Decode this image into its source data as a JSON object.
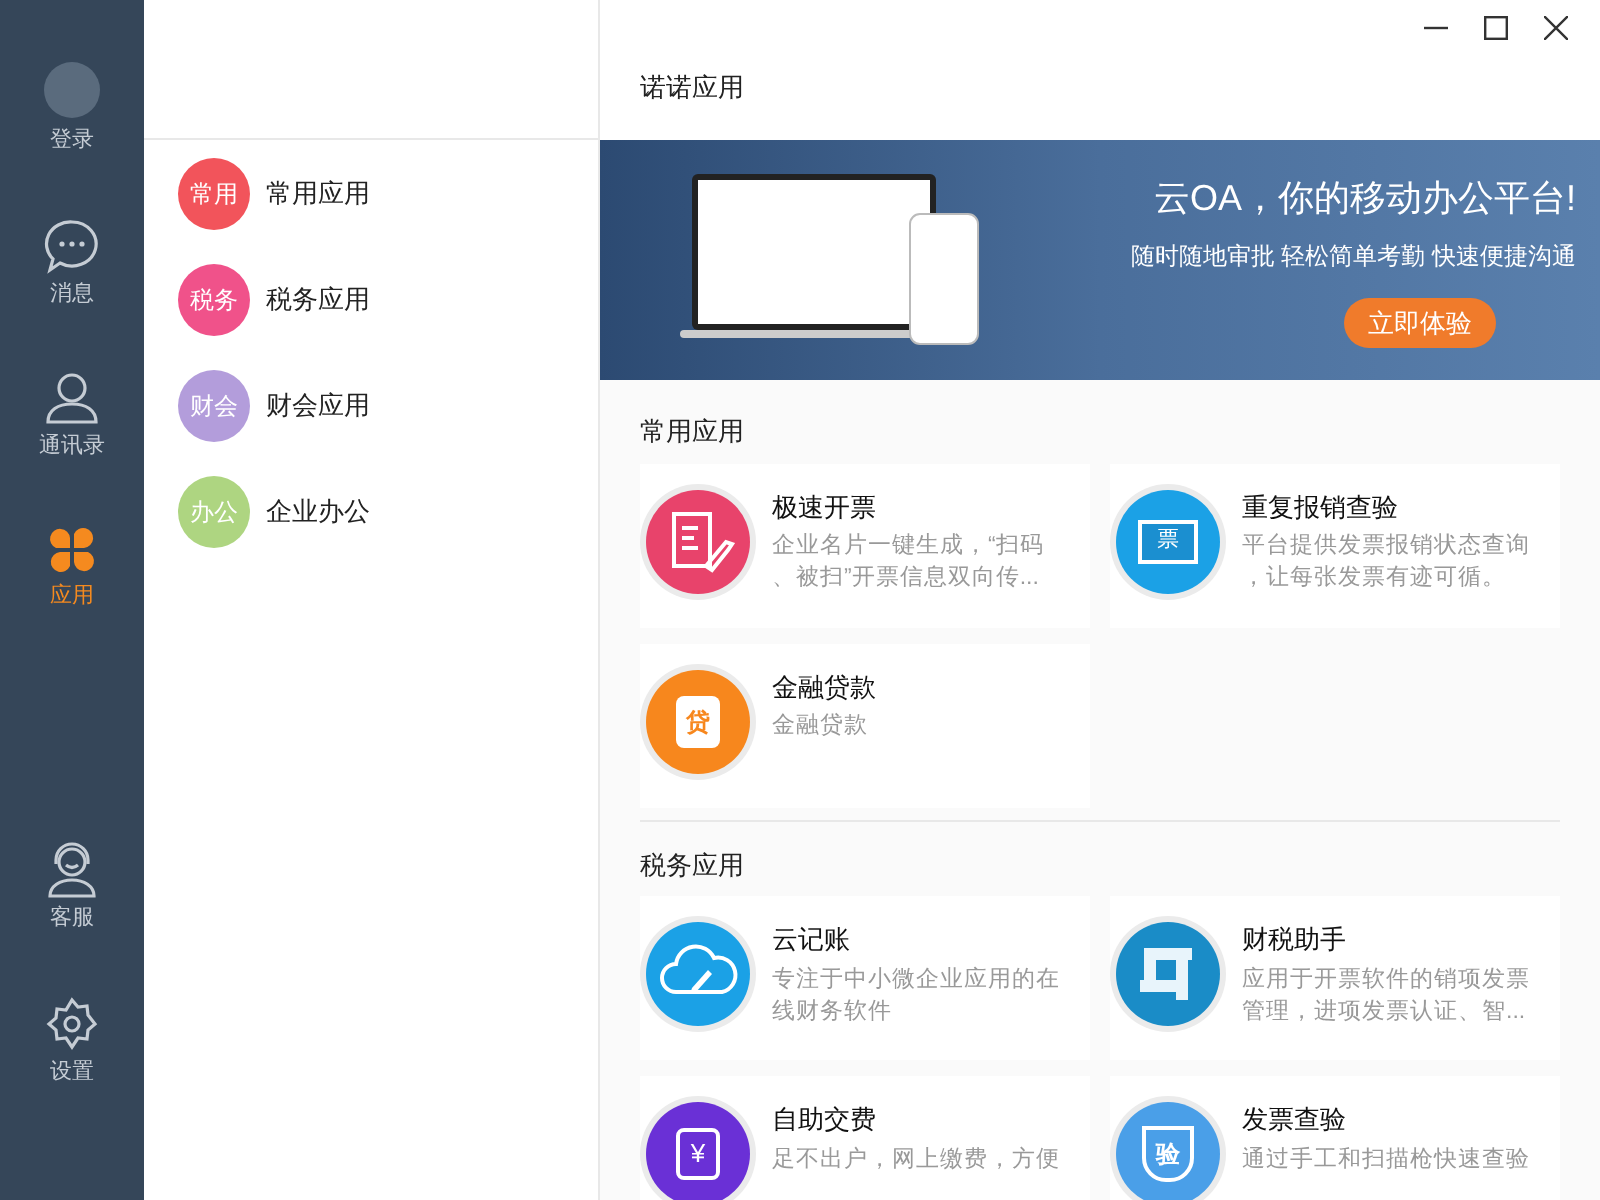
{
  "sidebar": {
    "items": [
      {
        "kind": "login",
        "label": "登录",
        "selected": false
      },
      {
        "kind": "messages",
        "label": "消息",
        "selected": false
      },
      {
        "kind": "contacts",
        "label": "通讯录",
        "selected": false
      },
      {
        "kind": "apps",
        "label": "应用",
        "selected": true
      },
      {
        "kind": "support",
        "label": "客服",
        "selected": false
      },
      {
        "kind": "settings",
        "label": "设置",
        "selected": false
      }
    ]
  },
  "categories": [
    {
      "badge": "常用",
      "label": "常用应用",
      "color": "#f2545b"
    },
    {
      "badge": "税务",
      "label": "税务应用",
      "color": "#f0528a"
    },
    {
      "badge": "财会",
      "label": "财会应用",
      "color": "#b39ddb"
    },
    {
      "badge": "办公",
      "label": "企业办公",
      "color": "#aed581"
    }
  ],
  "main": {
    "title": "诺诺应用",
    "banner": {
      "headline": "云OA，你的移动办公平台!",
      "subline": "随时随地审批 轻松简单考勤 快速便捷沟通",
      "button": "立即体验"
    },
    "sections": [
      {
        "title": "常用应用",
        "apps": [
          {
            "kind": "invoice",
            "name": "极速开票",
            "description": [
              "企业名片一键生成，“扫码",
              "、被扫”开票信息双向传..."
            ]
          },
          {
            "kind": "ticket",
            "glyph": "票",
            "name": "重复报销查验",
            "description": [
              "平台提供发票报销状态查询",
              "，让每张发票有迹可循。"
            ]
          },
          {
            "kind": "loan",
            "glyph": "贷",
            "name": "金融贷款",
            "description": [
              "金融贷款"
            ]
          }
        ]
      },
      {
        "title": "税务应用",
        "apps": [
          {
            "kind": "cloud",
            "name": "云记账",
            "description": [
              "专注于中小微企业应用的在",
              "线财务软件"
            ]
          },
          {
            "kind": "tax",
            "name": "财税助手",
            "description": [
              "应用于开票软件的销项发票",
              "管理，进项发票认证、智..."
            ]
          },
          {
            "kind": "payment",
            "glyph": "¥",
            "name": "自助交费",
            "description": [
              "足不出户，网上缴费，方便"
            ]
          },
          {
            "kind": "verify",
            "glyph": "验",
            "name": "发票查验",
            "description": [
              "通过手工和扫描枪快速查验"
            ]
          }
        ]
      }
    ]
  }
}
